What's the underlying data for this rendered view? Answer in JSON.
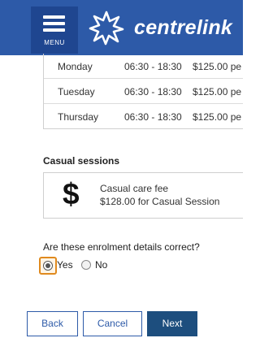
{
  "header": {
    "menu_label": "MENU",
    "logo_text": "centrelink",
    "bg_color": "#2d5aa8"
  },
  "schedule": {
    "rows": [
      {
        "day": "Monday",
        "time": "06:30 - 18:30",
        "fee": "$125.00 pe"
      },
      {
        "day": "Tuesday",
        "time": "06:30 - 18:30",
        "fee": "$125.00 pe"
      },
      {
        "day": "Thursday",
        "time": "06:30 - 18:30",
        "fee": "$125.00 pe"
      }
    ]
  },
  "casual": {
    "title": "Casual sessions",
    "icon": "dollar-icon",
    "symbol": "$",
    "line1": "Casual care fee",
    "line2": "$128.00 for Casual Session"
  },
  "confirm": {
    "question": "Are these enrolment details correct?",
    "yes_label": "Yes",
    "no_label": "No",
    "selected": "Yes"
  },
  "buttons": {
    "back": "Back",
    "cancel": "Cancel",
    "next": "Next"
  }
}
